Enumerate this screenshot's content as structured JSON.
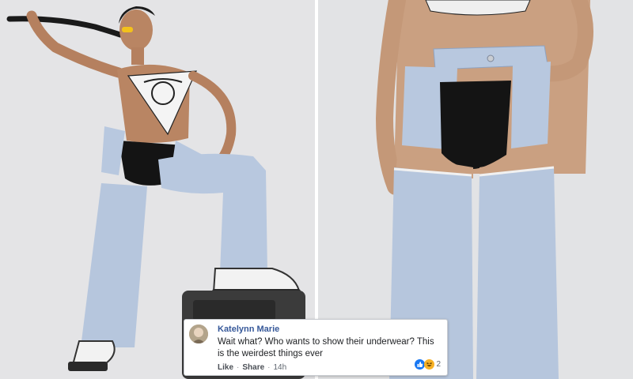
{
  "images": {
    "left_photo": {
      "subject": "model-in-cutout-jeans-full-body"
    },
    "right_photo": {
      "subject": "cutout-jeans-closeup"
    }
  },
  "comment": {
    "author": "Katelynn Marie",
    "text": "Wait what? Who wants to show their underwear? This is the weirdest things ever",
    "like_label": "Like",
    "share_label": "Share",
    "separator": "·",
    "time": "14h",
    "reaction_count": "2",
    "reaction_icons": [
      "like-icon",
      "haha-icon"
    ]
  },
  "colors": {
    "background": "#e4e4e6",
    "denim": "#b8c8df",
    "underwear": "#141414",
    "link": "#365899"
  }
}
